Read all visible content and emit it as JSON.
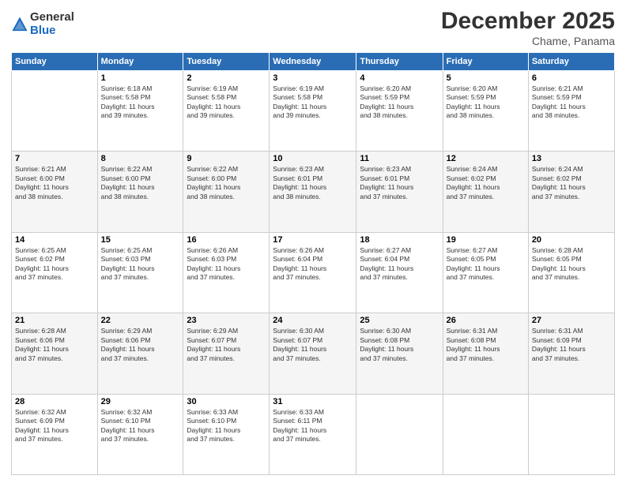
{
  "logo": {
    "general": "General",
    "blue": "Blue"
  },
  "header": {
    "month": "December 2025",
    "location": "Chame, Panama"
  },
  "weekdays": [
    "Sunday",
    "Monday",
    "Tuesday",
    "Wednesday",
    "Thursday",
    "Friday",
    "Saturday"
  ],
  "weeks": [
    [
      {
        "day": "",
        "info": ""
      },
      {
        "day": "1",
        "info": "Sunrise: 6:18 AM\nSunset: 5:58 PM\nDaylight: 11 hours\nand 39 minutes."
      },
      {
        "day": "2",
        "info": "Sunrise: 6:19 AM\nSunset: 5:58 PM\nDaylight: 11 hours\nand 39 minutes."
      },
      {
        "day": "3",
        "info": "Sunrise: 6:19 AM\nSunset: 5:58 PM\nDaylight: 11 hours\nand 39 minutes."
      },
      {
        "day": "4",
        "info": "Sunrise: 6:20 AM\nSunset: 5:59 PM\nDaylight: 11 hours\nand 38 minutes."
      },
      {
        "day": "5",
        "info": "Sunrise: 6:20 AM\nSunset: 5:59 PM\nDaylight: 11 hours\nand 38 minutes."
      },
      {
        "day": "6",
        "info": "Sunrise: 6:21 AM\nSunset: 5:59 PM\nDaylight: 11 hours\nand 38 minutes."
      }
    ],
    [
      {
        "day": "7",
        "info": "Sunrise: 6:21 AM\nSunset: 6:00 PM\nDaylight: 11 hours\nand 38 minutes."
      },
      {
        "day": "8",
        "info": "Sunrise: 6:22 AM\nSunset: 6:00 PM\nDaylight: 11 hours\nand 38 minutes."
      },
      {
        "day": "9",
        "info": "Sunrise: 6:22 AM\nSunset: 6:00 PM\nDaylight: 11 hours\nand 38 minutes."
      },
      {
        "day": "10",
        "info": "Sunrise: 6:23 AM\nSunset: 6:01 PM\nDaylight: 11 hours\nand 38 minutes."
      },
      {
        "day": "11",
        "info": "Sunrise: 6:23 AM\nSunset: 6:01 PM\nDaylight: 11 hours\nand 37 minutes."
      },
      {
        "day": "12",
        "info": "Sunrise: 6:24 AM\nSunset: 6:02 PM\nDaylight: 11 hours\nand 37 minutes."
      },
      {
        "day": "13",
        "info": "Sunrise: 6:24 AM\nSunset: 6:02 PM\nDaylight: 11 hours\nand 37 minutes."
      }
    ],
    [
      {
        "day": "14",
        "info": "Sunrise: 6:25 AM\nSunset: 6:02 PM\nDaylight: 11 hours\nand 37 minutes."
      },
      {
        "day": "15",
        "info": "Sunrise: 6:25 AM\nSunset: 6:03 PM\nDaylight: 11 hours\nand 37 minutes."
      },
      {
        "day": "16",
        "info": "Sunrise: 6:26 AM\nSunset: 6:03 PM\nDaylight: 11 hours\nand 37 minutes."
      },
      {
        "day": "17",
        "info": "Sunrise: 6:26 AM\nSunset: 6:04 PM\nDaylight: 11 hours\nand 37 minutes."
      },
      {
        "day": "18",
        "info": "Sunrise: 6:27 AM\nSunset: 6:04 PM\nDaylight: 11 hours\nand 37 minutes."
      },
      {
        "day": "19",
        "info": "Sunrise: 6:27 AM\nSunset: 6:05 PM\nDaylight: 11 hours\nand 37 minutes."
      },
      {
        "day": "20",
        "info": "Sunrise: 6:28 AM\nSunset: 6:05 PM\nDaylight: 11 hours\nand 37 minutes."
      }
    ],
    [
      {
        "day": "21",
        "info": "Sunrise: 6:28 AM\nSunset: 6:06 PM\nDaylight: 11 hours\nand 37 minutes."
      },
      {
        "day": "22",
        "info": "Sunrise: 6:29 AM\nSunset: 6:06 PM\nDaylight: 11 hours\nand 37 minutes."
      },
      {
        "day": "23",
        "info": "Sunrise: 6:29 AM\nSunset: 6:07 PM\nDaylight: 11 hours\nand 37 minutes."
      },
      {
        "day": "24",
        "info": "Sunrise: 6:30 AM\nSunset: 6:07 PM\nDaylight: 11 hours\nand 37 minutes."
      },
      {
        "day": "25",
        "info": "Sunrise: 6:30 AM\nSunset: 6:08 PM\nDaylight: 11 hours\nand 37 minutes."
      },
      {
        "day": "26",
        "info": "Sunrise: 6:31 AM\nSunset: 6:08 PM\nDaylight: 11 hours\nand 37 minutes."
      },
      {
        "day": "27",
        "info": "Sunrise: 6:31 AM\nSunset: 6:09 PM\nDaylight: 11 hours\nand 37 minutes."
      }
    ],
    [
      {
        "day": "28",
        "info": "Sunrise: 6:32 AM\nSunset: 6:09 PM\nDaylight: 11 hours\nand 37 minutes."
      },
      {
        "day": "29",
        "info": "Sunrise: 6:32 AM\nSunset: 6:10 PM\nDaylight: 11 hours\nand 37 minutes."
      },
      {
        "day": "30",
        "info": "Sunrise: 6:33 AM\nSunset: 6:10 PM\nDaylight: 11 hours\nand 37 minutes."
      },
      {
        "day": "31",
        "info": "Sunrise: 6:33 AM\nSunset: 6:11 PM\nDaylight: 11 hours\nand 37 minutes."
      },
      {
        "day": "",
        "info": ""
      },
      {
        "day": "",
        "info": ""
      },
      {
        "day": "",
        "info": ""
      }
    ]
  ]
}
